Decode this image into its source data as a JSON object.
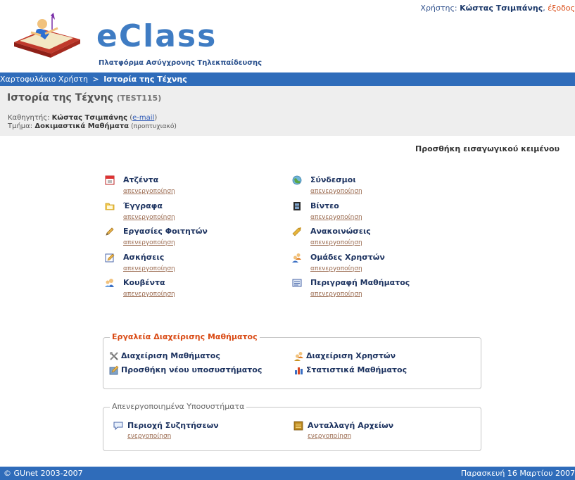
{
  "header": {
    "brand": "eClass",
    "tagline": "Πλατφόρμα Ασύγχρονης Τηλεκπαίδευσης",
    "user_prefix": "Χρήστης:",
    "user_name": "Κώστας Τσιμπάνης",
    "logout": "έξοδος"
  },
  "breadcrumb": {
    "home": "Χαρτοφυλάκιο Χρήστη",
    "separator": ">",
    "current": "Ιστορία της Τέχνης"
  },
  "course": {
    "title": "Ιστορία της Τέχνης",
    "code": "(TEST115)",
    "professor_label": "Καθηγητής:",
    "professor": "Κώστας Τσιμπάνης",
    "email_link": "e-mail",
    "department_label": "Τμήμα:",
    "department": "Δοκιμαστικά Μαθήματα",
    "level": "(προπτυχιακό)"
  },
  "add_intro_text": "Προσθήκη εισαγωγικού κειμένου",
  "tools_left": [
    {
      "name": "Ατζέντα",
      "toggle": "απενεργοποίηση",
      "icon": "calendar-icon"
    },
    {
      "name": "Έγγραφα",
      "toggle": "απενεργοποίηση",
      "icon": "folder-icon"
    },
    {
      "name": "Εργασίες Φοιτητών",
      "toggle": "απενεργοποίηση",
      "icon": "pencil-icon"
    },
    {
      "name": "Ασκήσεις",
      "toggle": "απενεργοποίηση",
      "icon": "exercise-icon"
    },
    {
      "name": "Κουβέντα",
      "toggle": "απενεργοποίηση",
      "icon": "chat-users-icon"
    }
  ],
  "tools_right": [
    {
      "name": "Σύνδεσμοι",
      "toggle": "απενεργοποίηση",
      "icon": "globe-icon"
    },
    {
      "name": "Βίντεο",
      "toggle": "απενεργοποίηση",
      "icon": "film-icon"
    },
    {
      "name": "Ανακοινώσεις",
      "toggle": "απενεργοποίηση",
      "icon": "megaphone-icon"
    },
    {
      "name": "Ομάδες Χρηστών",
      "toggle": "απενεργοποίηση",
      "icon": "users-group-icon"
    },
    {
      "name": "Περιγραφή Μαθήματος",
      "toggle": "απενεργοποίηση",
      "icon": "description-icon"
    }
  ],
  "admin": {
    "legend": "Εργαλεία Διαχείρισης Μαθήματος",
    "items": [
      {
        "name": "Διαχείριση Μαθήματος",
        "icon": "tools-icon"
      },
      {
        "name": "Διαχείριση Χρηστών",
        "icon": "user-admin-icon"
      },
      {
        "name": "Προσθήκη νέου υποσυστήματος",
        "icon": "add-module-icon"
      },
      {
        "name": "Στατιστικά Μαθήματος",
        "icon": "statistics-icon"
      }
    ]
  },
  "disabled": {
    "legend": "Απενεργοποιημένα Υποσυστήματα",
    "items": [
      {
        "name": "Περιοχή Συζητήσεων",
        "toggle": "ενεργοποίηση",
        "icon": "forum-icon"
      },
      {
        "name": "Ανταλλαγή Αρχείων",
        "toggle": "ενεργοποίηση",
        "icon": "file-exchange-icon"
      }
    ]
  },
  "footer": {
    "copyright": "© GUnet 2003-2007",
    "date": "Παρασκευή 16 Μαρτίου 2007"
  },
  "colors": {
    "bar_blue": "#2f6cba",
    "brand_blue": "#3f7cc3",
    "accent_orange": "#d94a14",
    "link_brown": "#9b6b50"
  }
}
